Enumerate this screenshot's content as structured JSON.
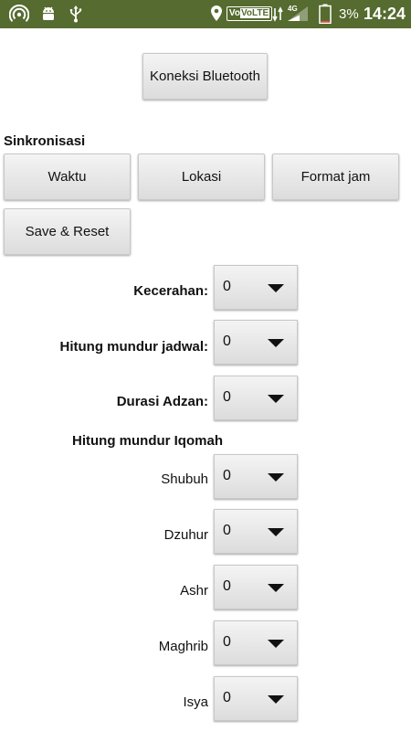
{
  "status_bar": {
    "battery_percent": "3%",
    "time": "14:24",
    "volte": "VoLTE",
    "network": "4G",
    "icons": [
      "hotspot-icon",
      "android-icon",
      "usb-icon",
      "location-icon",
      "volte-icon",
      "signal-icon",
      "battery-icon"
    ]
  },
  "bluetooth_button": "Koneksi Bluetooth",
  "sync": {
    "heading": "Sinkronisasi",
    "time_button": "Waktu",
    "location_button": "Lokasi",
    "clock_format_button": "Format jam",
    "save_reset_button": "Save & Reset"
  },
  "settings": {
    "brightness": {
      "label": "Kecerahan:",
      "value": "0"
    },
    "schedule_countdown": {
      "label": "Hitung mundur jadwal:",
      "value": "0"
    },
    "adzan_duration": {
      "label": "Durasi Adzan:",
      "value": "0"
    }
  },
  "iqomah": {
    "heading": "Hitung mundur Iqomah",
    "prayers": [
      {
        "name": "Shubuh",
        "value": "0"
      },
      {
        "name": "Dzuhur",
        "value": "0"
      },
      {
        "name": "Ashr",
        "value": "0"
      },
      {
        "name": "Maghrib",
        "value": "0"
      },
      {
        "name": "Isya",
        "value": "0"
      }
    ]
  },
  "colors": {
    "status_bar": "#556b2f",
    "button_face": "#e6e6e6",
    "text": "#111111"
  }
}
